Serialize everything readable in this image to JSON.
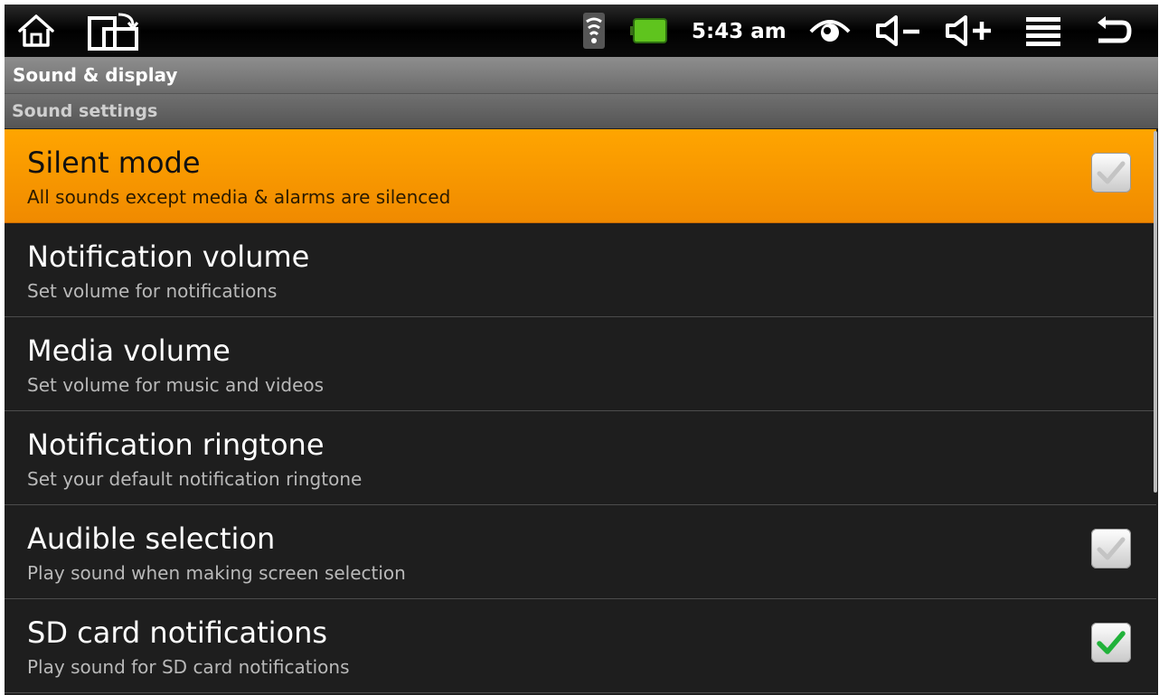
{
  "status": {
    "time": "5:43 am",
    "icons": [
      "home-icon",
      "rotate-screen-icon",
      "wifi-icon",
      "battery-icon",
      "eye-icon",
      "volume-down-icon",
      "volume-up-icon",
      "menu-icon",
      "back-icon"
    ]
  },
  "title_bar": {
    "title": "Sound & display"
  },
  "section": {
    "header": "Sound settings"
  },
  "items": [
    {
      "title": "Silent mode",
      "subtitle": "All sounds except media & alarms are silenced",
      "checkbox": true,
      "checked": false
    },
    {
      "title": "Notification volume",
      "subtitle": "Set volume for notifications"
    },
    {
      "title": "Media volume",
      "subtitle": "Set volume for music and videos"
    },
    {
      "title": "Notification ringtone",
      "subtitle": "Set your default notification ringtone"
    },
    {
      "title": "Audible selection",
      "subtitle": "Play sound when making screen selection",
      "checkbox": true,
      "checked": false
    },
    {
      "title": "SD card notifications",
      "subtitle": "Play sound for SD card notifications",
      "checkbox": true,
      "checked": true
    }
  ],
  "colors": {
    "highlight": "#ff9a00",
    "check_on": "#21b23a",
    "check_off": "#c4c4c4",
    "background": "#1e1e1e"
  }
}
